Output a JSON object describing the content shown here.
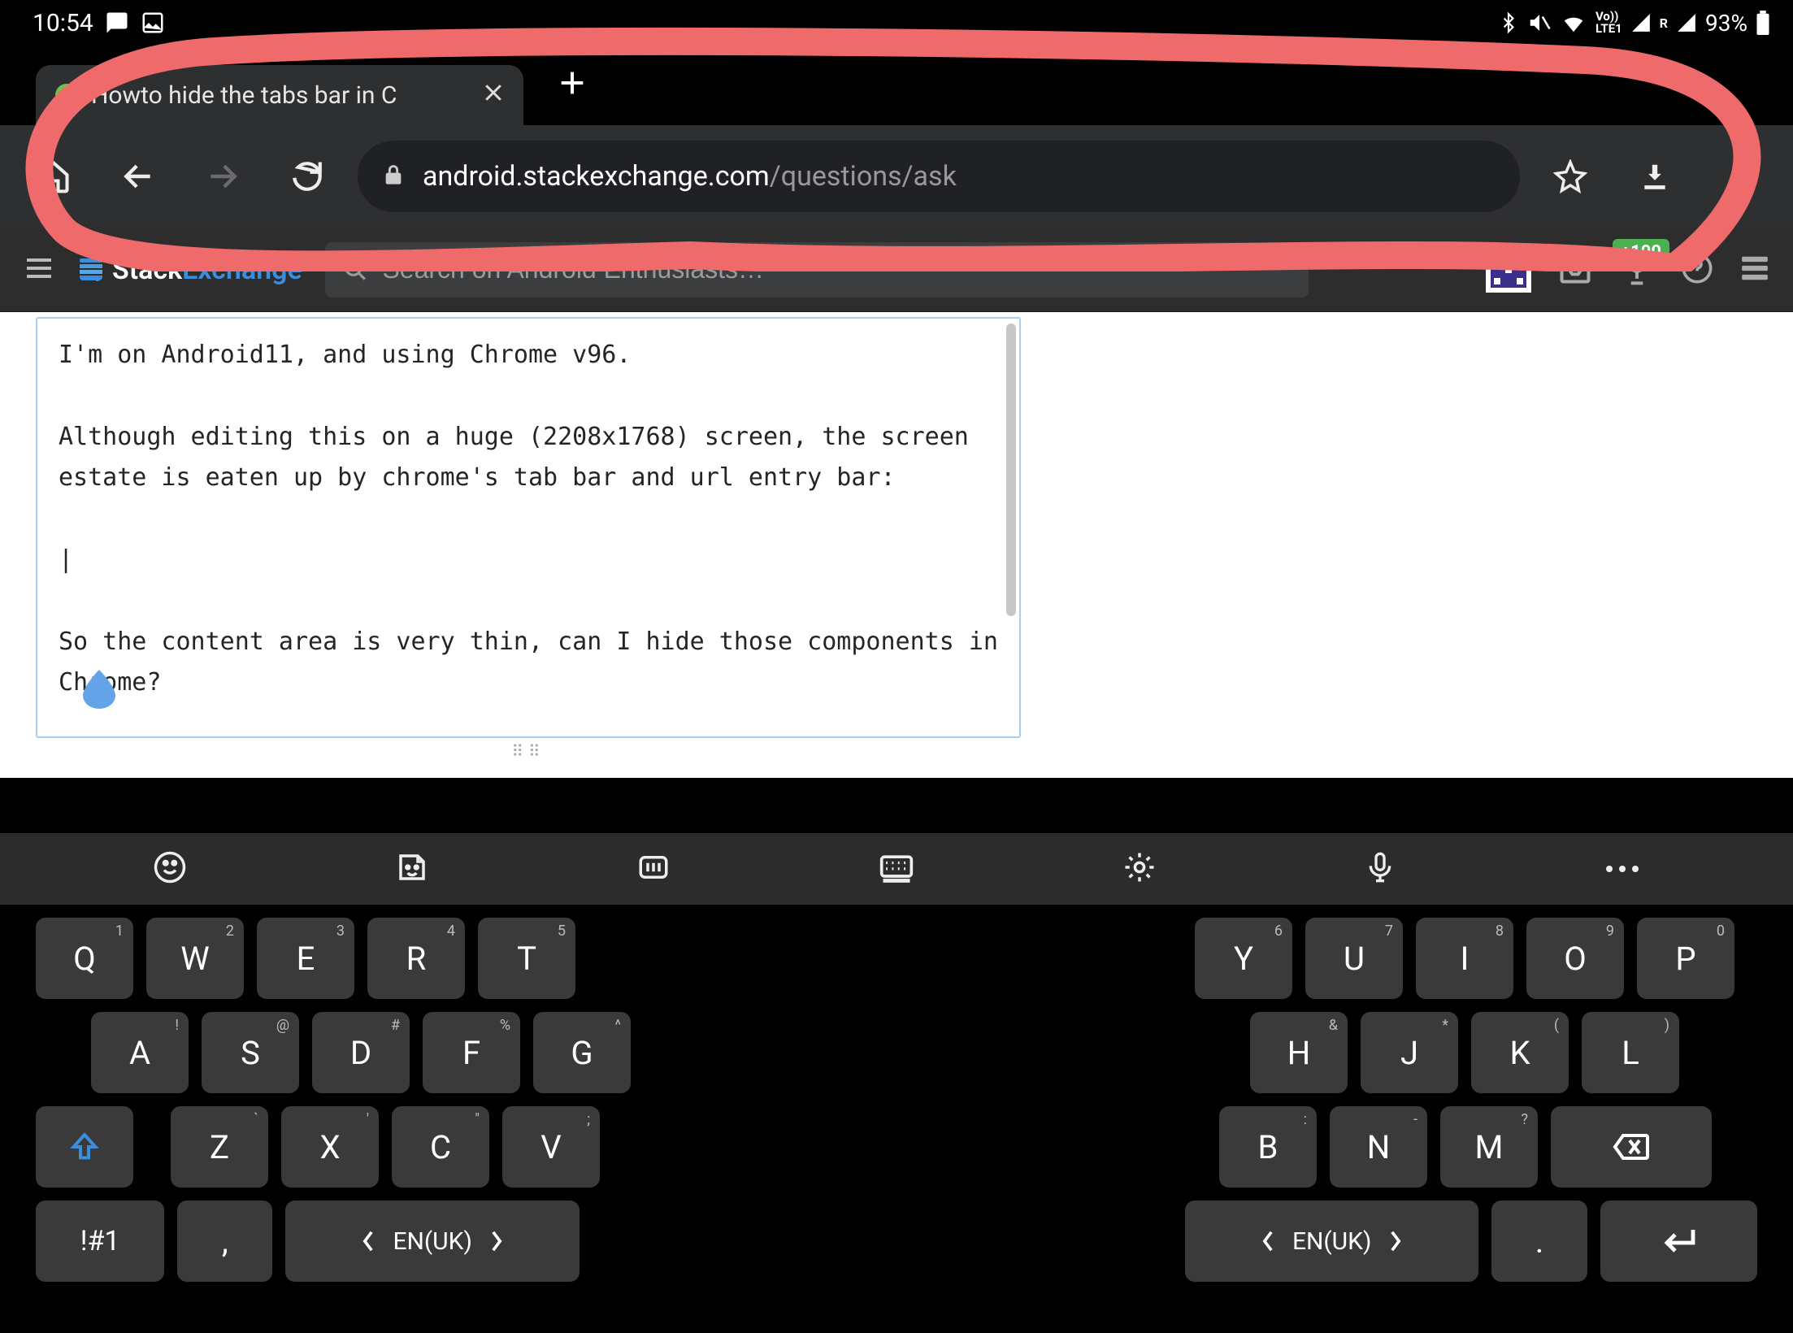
{
  "status": {
    "time": "10:54",
    "battery": "93%"
  },
  "browser": {
    "tab_title": "Howto hide the tabs bar in C",
    "url_domain": "android.stackexchange.com",
    "url_path": "/questions/ask"
  },
  "se_header": {
    "logo_stack": "Stack",
    "logo_exchange": "Exchange",
    "search_placeholder": "Search on Android Enthusiasts…",
    "rep_badge": "+100"
  },
  "editor": {
    "body": "I'm on Android11, and using Chrome v96.\n\nAlthough editing this on a huge (2208x1768) screen, the screen estate is eaten up by chrome's tab bar and url entry bar:\n\n|\n\nSo the content area is very thin, can I hide those components in Chrome?"
  },
  "keyboard": {
    "row1_left": [
      [
        "Q",
        "1"
      ],
      [
        "W",
        "2"
      ],
      [
        "E",
        "3"
      ],
      [
        "R",
        "4"
      ],
      [
        "T",
        "5"
      ]
    ],
    "row1_right": [
      [
        "Y",
        "6"
      ],
      [
        "U",
        "7"
      ],
      [
        "I",
        "8"
      ],
      [
        "O",
        "9"
      ],
      [
        "P",
        "0"
      ]
    ],
    "row2_left": [
      [
        "A",
        "!"
      ],
      [
        "S",
        "@"
      ],
      [
        "D",
        "#"
      ],
      [
        "F",
        "%"
      ],
      [
        "G",
        "^"
      ]
    ],
    "row2_right": [
      [
        "H",
        "&"
      ],
      [
        "J",
        "*"
      ],
      [
        "K",
        "("
      ],
      [
        "L",
        ")"
      ]
    ],
    "row3_left": [
      [
        "Z",
        "`"
      ],
      [
        "X",
        "'"
      ],
      [
        "C",
        "\""
      ],
      [
        "V",
        ";"
      ]
    ],
    "row3_right": [
      [
        "B",
        ":"
      ],
      [
        "N",
        "-"
      ],
      [
        "M",
        "?"
      ]
    ],
    "sym": "!#1",
    "comma": ",",
    "period": ".",
    "lang": "EN(UK)"
  }
}
